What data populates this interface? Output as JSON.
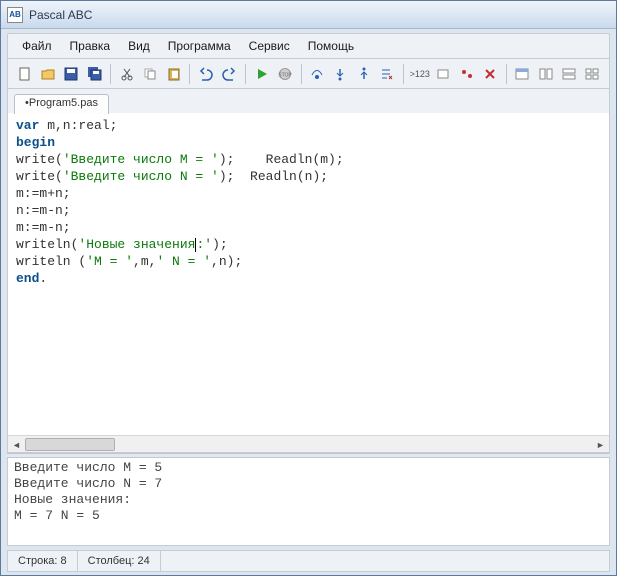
{
  "title": "Pascal ABC",
  "app_icon_text": "AB",
  "menu": [
    "Файл",
    "Правка",
    "Вид",
    "Программа",
    "Сервис",
    "Помощь"
  ],
  "toolbar_icons": [
    "new-file-icon",
    "open-file-icon",
    "save-icon",
    "save-all-icon",
    "sep",
    "cut-icon",
    "copy-icon",
    "paste-icon",
    "sep",
    "undo-icon",
    "redo-icon",
    "sep",
    "run-icon",
    "stop-icon",
    "sep",
    "step-over-icon",
    "step-into-icon",
    "step-out-icon",
    "run-to-cursor-icon",
    "sep",
    "watch-icon",
    "breakpoint-toggle-icon",
    "breakpoint-list-icon",
    "clear-breakpoints-icon",
    "sep",
    "window1-icon",
    "window2-icon",
    "window3-icon",
    "window4-icon"
  ],
  "tab": {
    "label": "•Program5.pas"
  },
  "code": {
    "l1_kw": "var",
    "l1_rest": " m,n:real;",
    "l2_kw": "begin",
    "l3a": "write(",
    "l3s": "'Введите число M = '",
    "l3b": ");    Readln(m);",
    "l4a": "write(",
    "l4s": "'Введите число N = '",
    "l4b": ");  Readln(n);",
    "l5": "m:=m+n;",
    "l6": "n:=m-n;",
    "l7": "m:=m-n;",
    "l8a": "writeln(",
    "l8s1": "'Новые значения",
    "l8s2": ":'",
    "l8b": ");",
    "l9a": "writeln (",
    "l9s1": "'M = '",
    "l9b": ",m,",
    "l9s2": "' N = '",
    "l9c": ",n);",
    "l10_kw": "end",
    "l10_rest": "."
  },
  "output_lines": [
    "Введите число M = 5",
    "Введите число N = 7",
    "Новые значения:",
    "M = 7 N = 5"
  ],
  "status": {
    "line_label": "Строка:",
    "line_value": "8",
    "col_label": "Столбец:",
    "col_value": "24"
  }
}
